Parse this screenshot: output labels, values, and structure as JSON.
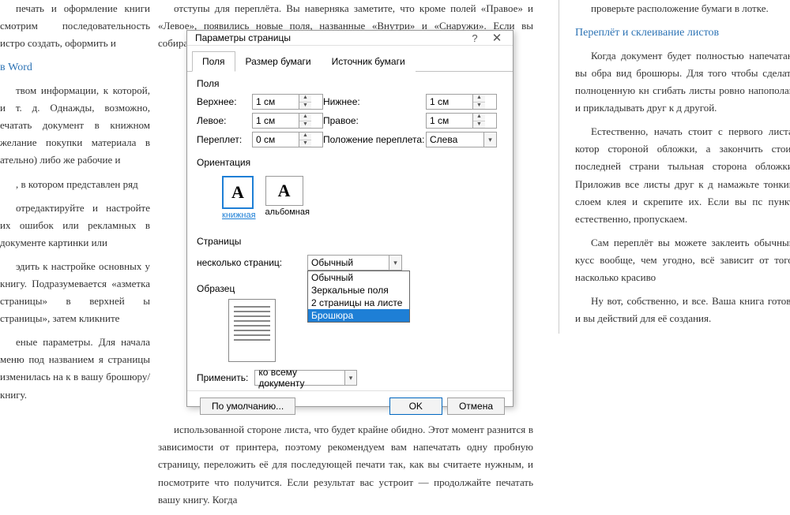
{
  "doc": {
    "left": [
      "печать и оформление книги смотрим последовательность истро создать, оформить и",
      "в Word",
      "твом информации, к которой, и т. д. Однажды, возможно, ечатать документ в книжном желание покупки материала в ательно) либо же рабочие и",
      ", в котором представлен ряд",
      "отредактируйте и настройте их ошибок или рекламных в документе картинки или",
      "эдить к настройке основных у книгу. Подразумевается «азметка страницы» в верхней ы страницы», затем кликните",
      "еные параметры. Для начала меню под названием я страницы изменилась на к в вашу брошюру/книгу."
    ],
    "mid_top": "отступы для переплёта. Вы наверняка заметите, что кроме полей «Правое» и «Левое», появились новые поля, названные «Внутри» и «Снаружи». Если вы собираетесь делать",
    "mid_bottom": "использованной стороне листа, что будет крайне обидно. Этот момент разнится в зависимости от принтера, поэтому рекомендуем вам напечатать одну пробную страницу, переложить её для последующей печати так, как вы считаете нужным, и посмотрите что получится. Если результат вас устроит — продолжайте печатать вашу книгу. Когда",
    "right_heading": "Переплёт и склеивание листов",
    "right": [
      "проверьте расположение бумаги в лотке.",
      "Когда документ будет полностью напечатан, вы обра вид брошюры. Для того чтобы сделать полноценную кн сгибать листы ровно напополам и прикладывать друг к д другой.",
      "Естественно, начать стоит с первого листа, котор стороной обложки, а закончить стоит последней страни тыльная сторона обложки. Приложив все листы друг к д намажьте тонким слоем клея и скрепите их. Если вы пс пункт, естественно, пропускаем.",
      "Сам переплёт вы можете заклеить обычным кусс вообще, чем угодно, всё зависит от того, насколько красиво",
      "Ну вот, собственно, и все. Ваша книга готова и вы действий для её создания."
    ]
  },
  "dialog": {
    "title": "Параметры страницы",
    "tabs": {
      "fields": "Поля",
      "paper": "Размер бумаги",
      "source": "Источник бумаги"
    },
    "labels": {
      "fields": "Поля",
      "top": "Верхнее:",
      "bottom": "Нижнее:",
      "left": "Левое:",
      "right": "Правое:",
      "gutter": "Переплет:",
      "gutter_pos": "Положение переплета:",
      "orient": "Ориентация",
      "portrait": "книжная",
      "landscape": "альбомная",
      "pages": "Страницы",
      "multi": "несколько страниц:",
      "preview": "Образец",
      "apply": "Применить:"
    },
    "values": {
      "top": "1 см",
      "bottom": "1 см",
      "left": "1 см",
      "right": "1 см",
      "gutter": "0 см",
      "gutter_pos": "Слева",
      "multi": "Обычный",
      "apply": "ко всему документу"
    },
    "dropdown": [
      "Обычный",
      "Зеркальные поля",
      "2 страницы на листе",
      "Брошюра"
    ],
    "buttons": {
      "default": "По умолчанию...",
      "ok": "OK",
      "cancel": "Отмена"
    }
  }
}
